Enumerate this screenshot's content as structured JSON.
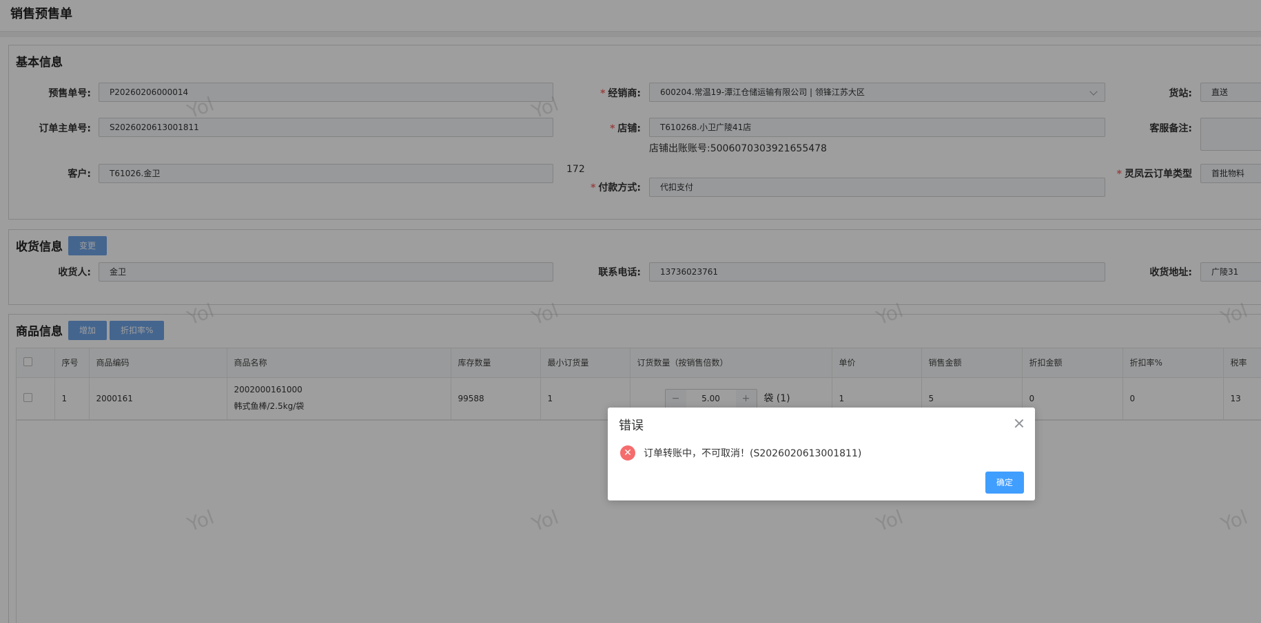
{
  "page": {
    "title": "销售预售单"
  },
  "basic": {
    "title": "基本信息",
    "presale_no": {
      "label": "预售单号:",
      "value": "P20260206000014"
    },
    "order_main_no": {
      "label": "订单主单号:",
      "value": "S2026020613001811"
    },
    "customer": {
      "label": "客户:",
      "value": "T61026.金卫",
      "extra": "172"
    },
    "distributor": {
      "label": "经销商:",
      "value": "600204.常温19-潭江仓储运输有限公司 | 领锋江苏大区"
    },
    "store": {
      "label": "店铺:",
      "value": "T610268.小卫广陵41店",
      "account": "店铺出账账号:5006070303921655478"
    },
    "payment": {
      "label": "付款方式:",
      "value": "代扣支付"
    },
    "station": {
      "label": "货站:",
      "value": "直送"
    },
    "cs_note": {
      "label": "客服备注:",
      "value": ""
    },
    "cloud_type": {
      "label": "灵凤云订单类型",
      "value": "首批物料"
    }
  },
  "receipt": {
    "title": "收货信息",
    "change_btn": "变更",
    "receiver": {
      "label": "收货人:",
      "value": "金卫"
    },
    "phone": {
      "label": "联系电话:",
      "value": "13736023761"
    },
    "address": {
      "label": "收货地址:",
      "value": "广陵31"
    }
  },
  "goods": {
    "title": "商品信息",
    "add_btn": "增加",
    "discount_btn": "折扣率%",
    "columns": [
      "序号",
      "商品编码",
      "商品名称",
      "库存数量",
      "最小订货量",
      "订货数量（按销售倍数）",
      "单价",
      "销售金额",
      "折扣金额",
      "折扣率%",
      "税率"
    ],
    "rows": [
      {
        "seq": "1",
        "code": "2000161",
        "name_code": "2002000161000",
        "name": "韩式鱼棒/2.5kg/袋",
        "stock": "99588",
        "min_qty": "1",
        "qty": "5.00",
        "unit": "袋 (1)",
        "price": "1",
        "amount": "5",
        "discount_amount": "0",
        "discount_rate": "0",
        "tax": "13"
      }
    ]
  },
  "watermark": "Yol",
  "dialog": {
    "title": "错误",
    "message": "订单转账中，不可取消！(S2026020613001811)",
    "ok": "确定"
  }
}
